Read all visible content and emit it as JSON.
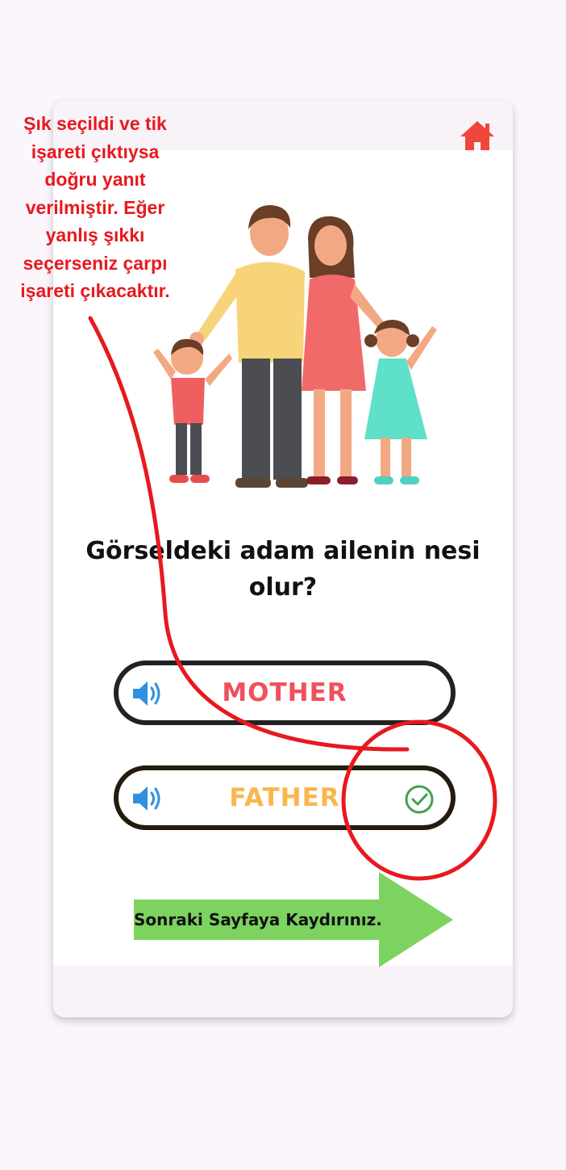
{
  "annotation": {
    "lines": [
      "Şık seçildi ve tik",
      "işareti çıktıysa",
      "doğru yanıt",
      "verilmiştir. Eğer",
      "yanlış şıkkı",
      "seçerseniz çarpı",
      "işareti çıkacaktır."
    ],
    "color": "#e7191f"
  },
  "header": {
    "home_icon": "home-icon",
    "home_color": "#f0463c"
  },
  "question": {
    "line1": "Görseldeki adam ailenin nesi",
    "line2": "olur?"
  },
  "options": [
    {
      "label": "MOTHER",
      "icon": "speaker-icon",
      "color": "#f0505c",
      "selected": false
    },
    {
      "label": "FATHER",
      "icon": "speaker-icon",
      "color": "#f9b64d",
      "selected": true,
      "status_icon": "check-circle-icon",
      "status_color": "#3fa34d"
    }
  ],
  "navigation": {
    "next_label": "Sonraki Sayfaya Kaydırınız.",
    "arrow_color": "#7cd35f"
  },
  "colors": {
    "accent_speaker": "#2f8fe0",
    "card_border": "#222222"
  }
}
